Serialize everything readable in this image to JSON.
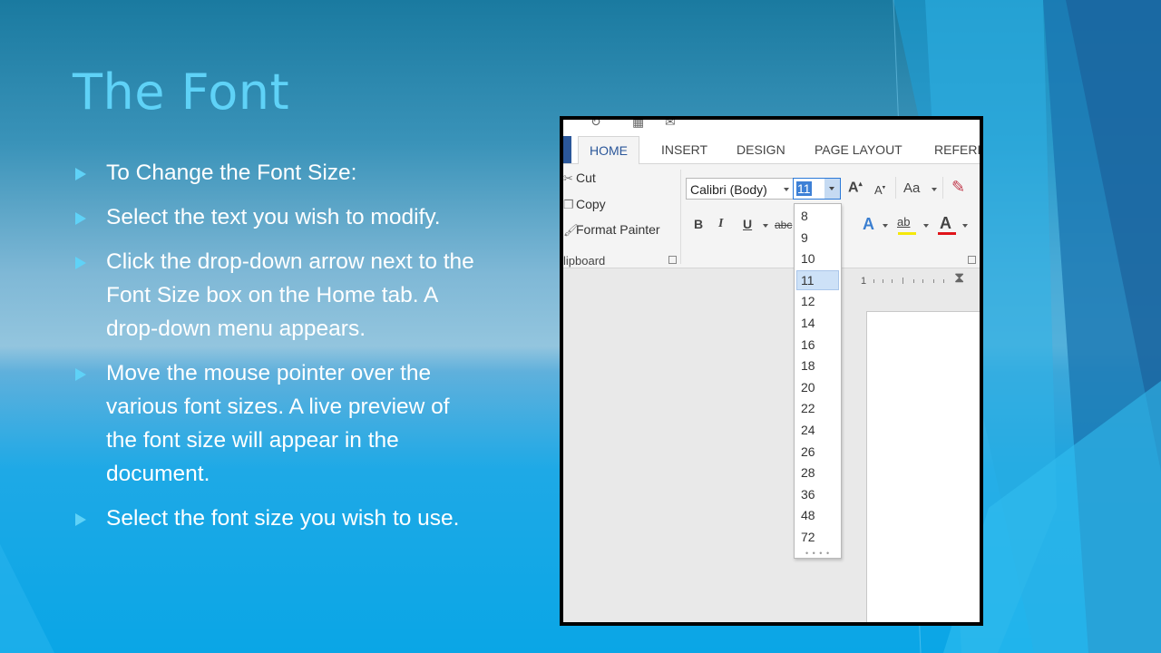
{
  "slide": {
    "title": "The Font",
    "colors": {
      "title": "#5fd2f7",
      "bullet_arrow": "#5fd2f7",
      "text": "#ffffff",
      "background": "#0aa6e6"
    },
    "bullets": [
      "To Change the Font Size:",
      "Select the text you wish to modify.",
      "Click the drop-down arrow next to the Font Size box on the Home tab. A drop-down menu appears.",
      "Move the mouse pointer over the various font sizes. A live preview of the font size will appear in the document.",
      "Select the font size you wish to use."
    ]
  },
  "word": {
    "tabs": [
      "HOME",
      "INSERT",
      "DESIGN",
      "PAGE LAYOUT",
      "REFERE"
    ],
    "active_tab": "HOME",
    "clipboard": {
      "cut": "Cut",
      "copy": "Copy",
      "format_painter": "Format Painter",
      "group_label": "lipboard"
    },
    "font": {
      "name": "Calibri (Body)",
      "size": "11",
      "grow_label": "A",
      "shrink_label": "A",
      "case_label": "Aa",
      "bold": "B",
      "italic": "I",
      "underline": "U",
      "strike": "abc",
      "text_effects": "A",
      "highlight": "ab",
      "font_color": "A"
    },
    "ruler_label": "1",
    "size_menu": {
      "items": [
        "8",
        "9",
        "10",
        "11",
        "12",
        "14",
        "16",
        "18",
        "20",
        "22",
        "24",
        "26",
        "28",
        "36",
        "48",
        "72"
      ],
      "hovered": "11"
    },
    "colors": {
      "accent": "#2b579a",
      "selection": "#3d80d6",
      "highlight_bar": "#f5e80a",
      "font_color_bar": "#e0141a",
      "hover": "#cde1f7"
    }
  }
}
